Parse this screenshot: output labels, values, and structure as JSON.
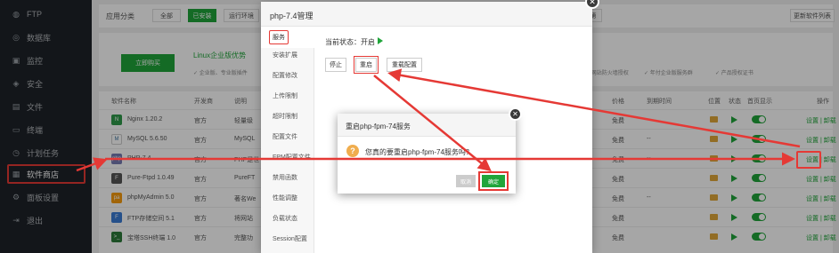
{
  "sidebar": {
    "items": [
      {
        "label": "FTP",
        "icon": "ftp-icon",
        "glyph": "◍"
      },
      {
        "label": "数据库",
        "icon": "database-icon",
        "glyph": "◎"
      },
      {
        "label": "监控",
        "icon": "monitor-icon",
        "glyph": "▣"
      },
      {
        "label": "安全",
        "icon": "shield-icon",
        "glyph": "◈"
      },
      {
        "label": "文件",
        "icon": "folder-icon",
        "glyph": "▤"
      },
      {
        "label": "终端",
        "icon": "terminal-icon",
        "glyph": "▭"
      },
      {
        "label": "计划任务",
        "icon": "clock-icon",
        "glyph": "◷"
      },
      {
        "label": "软件商店",
        "icon": "grid-icon",
        "glyph": "▦"
      },
      {
        "label": "面板设置",
        "icon": "gear-icon",
        "glyph": "⚙"
      },
      {
        "label": "退出",
        "icon": "logout-icon",
        "glyph": "⇥"
      }
    ]
  },
  "topbar": {
    "label": "应用分类",
    "buttons": [
      "全部",
      "已安装",
      "运行环境"
    ],
    "right_tab": "第",
    "update_button": "更新软件列表"
  },
  "promo": {
    "buy_button": "立即购买",
    "title": "Linux企业版优势",
    "features": [
      "✓ 企业版、专业版插件",
      "✓ 网站防火墙授权",
      "✓ 年付企业版服务群",
      "✓ 产品授权证书"
    ]
  },
  "table": {
    "headers": [
      "软件名称",
      "开发商",
      "说明",
      "价格",
      "到期时间",
      "位置",
      "状态",
      "首页显示",
      "操作"
    ],
    "rows": [
      {
        "name": "Nginx 1.20.2",
        "dev": "官方",
        "desc": "轻量级",
        "price": "免费",
        "expire": "",
        "op": "设置 | 卸载",
        "ico": "N"
      },
      {
        "name": "MySQL 5.6.50",
        "dev": "官方",
        "desc": "MySQL",
        "price": "免费",
        "expire": "--",
        "op": "设置 | 卸载",
        "ico": "M"
      },
      {
        "name": "PHP-7.4",
        "dev": "官方",
        "desc": "PHP是世",
        "price": "免费",
        "expire": "--",
        "op": "设置 | 卸载",
        "ico": "php"
      },
      {
        "name": "Pure-Ftpd 1.0.49",
        "dev": "官方",
        "desc": "PureFT",
        "price": "免费",
        "expire": "",
        "op": "设置 | 卸载",
        "ico": "F"
      },
      {
        "name": "phpMyAdmin 5.0",
        "dev": "官方",
        "desc": "著名We",
        "price": "免费",
        "expire": "--",
        "op": "设置 | 卸载",
        "ico": "pa"
      },
      {
        "name": "FTP存储空间 5.1",
        "dev": "官方",
        "desc": "将网站",
        "price": "免费",
        "expire": "",
        "op": "设置 | 卸载",
        "ico": "F"
      },
      {
        "name": "宝塔SSH终端 1.0",
        "dev": "官方",
        "desc": "完整功",
        "price": "免费",
        "expire": "",
        "op": "设置 | 卸载",
        "ico": ">_"
      }
    ]
  },
  "modal": {
    "title": "php-7.4管理",
    "tabs": [
      "服务",
      "安装扩展",
      "配置修改",
      "上传限制",
      "超时限制",
      "配置文件",
      "FPM配置文件",
      "禁用函数",
      "性能调整",
      "负载状态",
      "Session配置"
    ],
    "status_label": "当前状态：开启",
    "buttons": [
      "停止",
      "重启",
      "重载配置"
    ]
  },
  "confirm": {
    "title": "重启php-fpm-74服务",
    "message": "您真的要重启php-fpm-74服务吗？",
    "cancel": "取消",
    "ok": "确定",
    "watermark": "lbsanju.com"
  },
  "colors": {
    "accent": "#20a53a",
    "highlight": "#e53935",
    "sidebar": "#1e2329"
  }
}
